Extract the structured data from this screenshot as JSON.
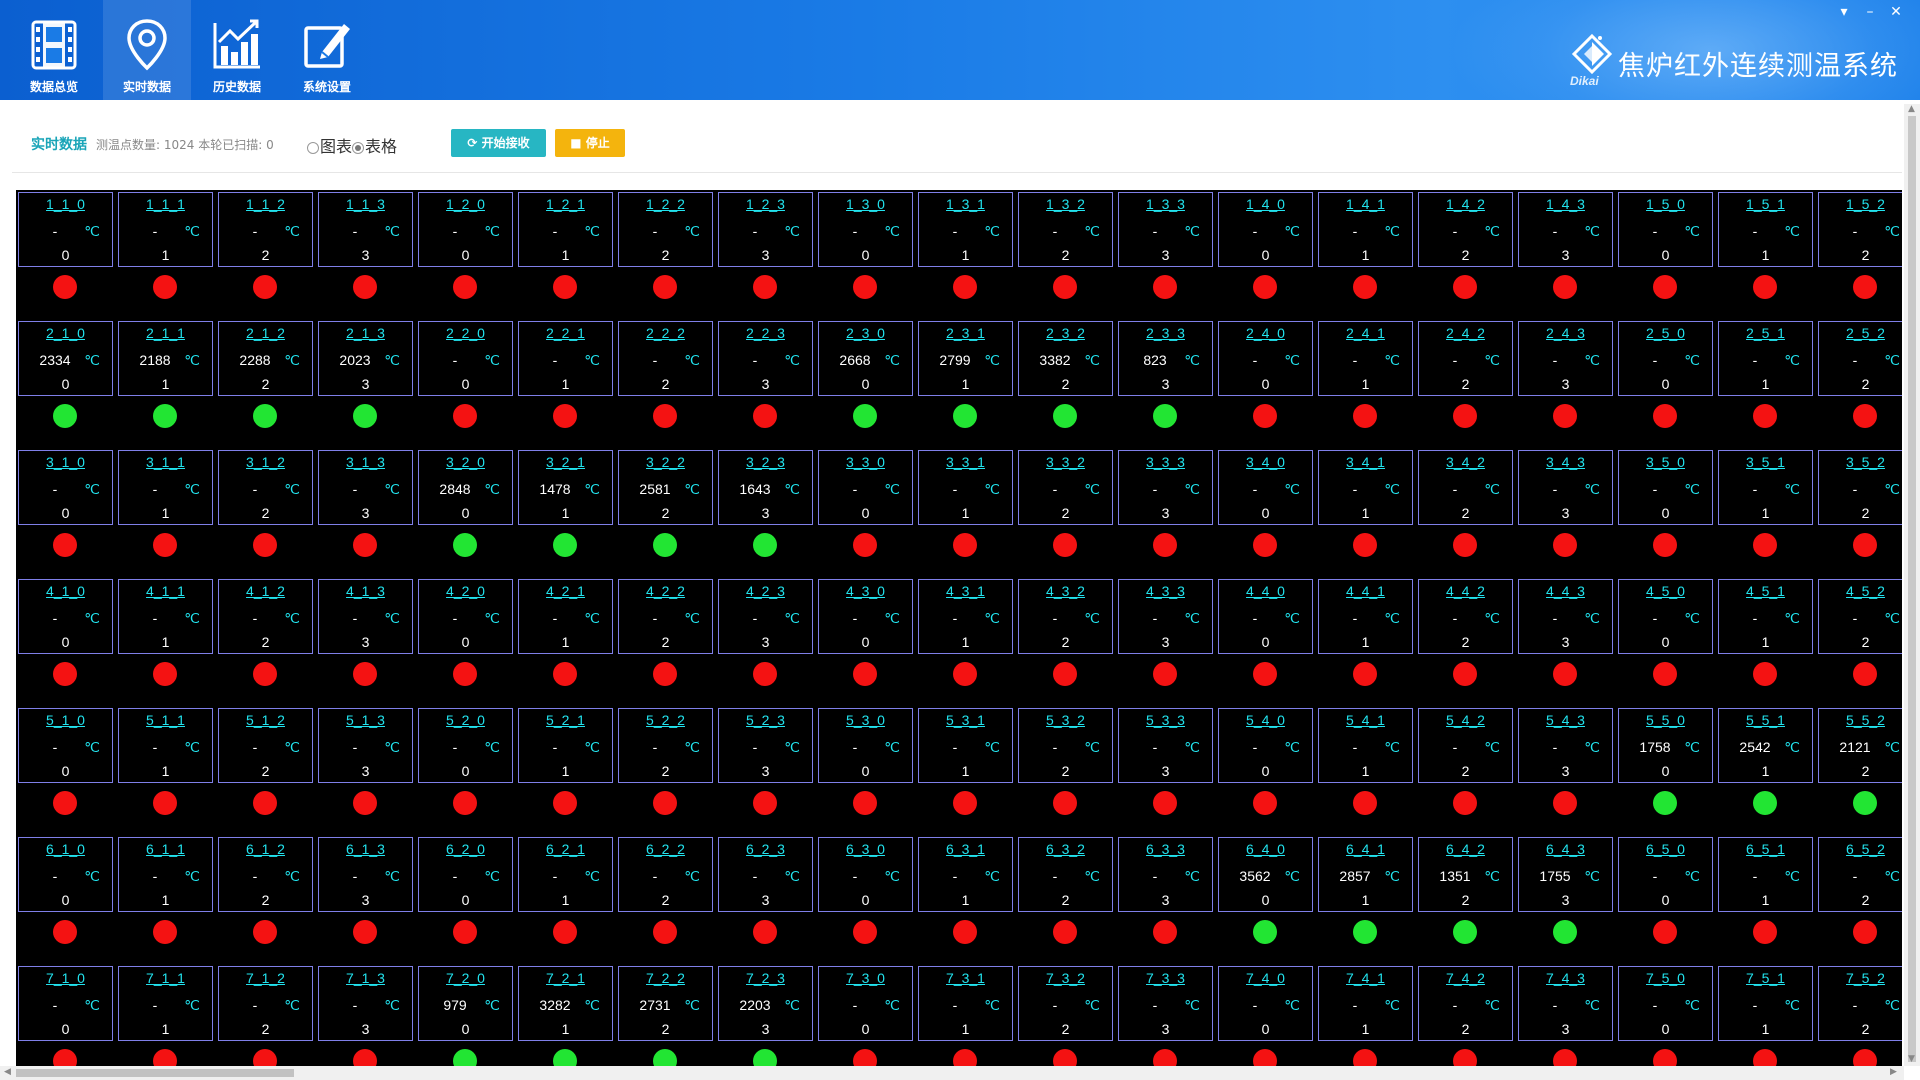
{
  "header": {
    "nav": [
      {
        "label": "数据总览",
        "icon": "film-icon"
      },
      {
        "label": "实时数据",
        "icon": "location-pin-icon"
      },
      {
        "label": "历史数据",
        "icon": "bar-chart-icon"
      },
      {
        "label": "系统设置",
        "icon": "edit-icon"
      }
    ],
    "active_nav": 1,
    "app_title": "焦炉红外连续测温系统",
    "logo_text": "Dikai",
    "controls": {
      "menu": "▾",
      "minimize": "–",
      "close": "✕"
    }
  },
  "toolbar": {
    "title": "实时数据",
    "count_text": "测温点数量: 1024 本轮已扫描: 0",
    "view_options": [
      {
        "label": "图表",
        "checked": false
      },
      {
        "label": "表格",
        "checked": true
      }
    ],
    "start_label": "开始接收",
    "stop_label": "停止"
  },
  "grid": {
    "unit": "℃",
    "colors": {
      "ok": "#22e533",
      "bad": "#f41212",
      "id": "#22e3ee",
      "border": "#7f7fe8"
    },
    "rows": [
      {
        "row": 1,
        "cells": [
          {
            "id": "1_1_0",
            "value": "-",
            "sub": "0",
            "ok": false
          },
          {
            "id": "1_1_1",
            "value": "-",
            "sub": "1",
            "ok": false
          },
          {
            "id": "1_1_2",
            "value": "-",
            "sub": "2",
            "ok": false
          },
          {
            "id": "1_1_3",
            "value": "-",
            "sub": "3",
            "ok": false
          },
          {
            "id": "1_2_0",
            "value": "-",
            "sub": "0",
            "ok": false
          },
          {
            "id": "1_2_1",
            "value": "-",
            "sub": "1",
            "ok": false
          },
          {
            "id": "1_2_2",
            "value": "-",
            "sub": "2",
            "ok": false
          },
          {
            "id": "1_2_3",
            "value": "-",
            "sub": "3",
            "ok": false
          },
          {
            "id": "1_3_0",
            "value": "-",
            "sub": "0",
            "ok": false
          },
          {
            "id": "1_3_1",
            "value": "-",
            "sub": "1",
            "ok": false
          },
          {
            "id": "1_3_2",
            "value": "-",
            "sub": "2",
            "ok": false
          },
          {
            "id": "1_3_3",
            "value": "-",
            "sub": "3",
            "ok": false
          },
          {
            "id": "1_4_0",
            "value": "-",
            "sub": "0",
            "ok": false
          },
          {
            "id": "1_4_1",
            "value": "-",
            "sub": "1",
            "ok": false
          },
          {
            "id": "1_4_2",
            "value": "-",
            "sub": "2",
            "ok": false
          },
          {
            "id": "1_4_3",
            "value": "-",
            "sub": "3",
            "ok": false
          },
          {
            "id": "1_5_0",
            "value": "-",
            "sub": "0",
            "ok": false
          },
          {
            "id": "1_5_1",
            "value": "-",
            "sub": "1",
            "ok": false
          },
          {
            "id": "1_5_2",
            "value": "-",
            "sub": "2",
            "ok": false
          }
        ]
      },
      {
        "row": 2,
        "cells": [
          {
            "id": "2_1_0",
            "value": "2334",
            "sub": "0",
            "ok": true
          },
          {
            "id": "2_1_1",
            "value": "2188",
            "sub": "1",
            "ok": true
          },
          {
            "id": "2_1_2",
            "value": "2288",
            "sub": "2",
            "ok": true
          },
          {
            "id": "2_1_3",
            "value": "2023",
            "sub": "3",
            "ok": true
          },
          {
            "id": "2_2_0",
            "value": "-",
            "sub": "0",
            "ok": false
          },
          {
            "id": "2_2_1",
            "value": "-",
            "sub": "1",
            "ok": false
          },
          {
            "id": "2_2_2",
            "value": "-",
            "sub": "2",
            "ok": false
          },
          {
            "id": "2_2_3",
            "value": "-",
            "sub": "3",
            "ok": false
          },
          {
            "id": "2_3_0",
            "value": "2668",
            "sub": "0",
            "ok": true
          },
          {
            "id": "2_3_1",
            "value": "2799",
            "sub": "1",
            "ok": true
          },
          {
            "id": "2_3_2",
            "value": "3382",
            "sub": "2",
            "ok": true
          },
          {
            "id": "2_3_3",
            "value": "823",
            "sub": "3",
            "ok": true
          },
          {
            "id": "2_4_0",
            "value": "-",
            "sub": "0",
            "ok": false
          },
          {
            "id": "2_4_1",
            "value": "-",
            "sub": "1",
            "ok": false
          },
          {
            "id": "2_4_2",
            "value": "-",
            "sub": "2",
            "ok": false
          },
          {
            "id": "2_4_3",
            "value": "-",
            "sub": "3",
            "ok": false
          },
          {
            "id": "2_5_0",
            "value": "-",
            "sub": "0",
            "ok": false
          },
          {
            "id": "2_5_1",
            "value": "-",
            "sub": "1",
            "ok": false
          },
          {
            "id": "2_5_2",
            "value": "-",
            "sub": "2",
            "ok": false
          }
        ]
      },
      {
        "row": 3,
        "cells": [
          {
            "id": "3_1_0",
            "value": "-",
            "sub": "0",
            "ok": false
          },
          {
            "id": "3_1_1",
            "value": "-",
            "sub": "1",
            "ok": false
          },
          {
            "id": "3_1_2",
            "value": "-",
            "sub": "2",
            "ok": false
          },
          {
            "id": "3_1_3",
            "value": "-",
            "sub": "3",
            "ok": false
          },
          {
            "id": "3_2_0",
            "value": "2848",
            "sub": "0",
            "ok": true
          },
          {
            "id": "3_2_1",
            "value": "1478",
            "sub": "1",
            "ok": true
          },
          {
            "id": "3_2_2",
            "value": "2581",
            "sub": "2",
            "ok": true
          },
          {
            "id": "3_2_3",
            "value": "1643",
            "sub": "3",
            "ok": true
          },
          {
            "id": "3_3_0",
            "value": "-",
            "sub": "0",
            "ok": false
          },
          {
            "id": "3_3_1",
            "value": "-",
            "sub": "1",
            "ok": false
          },
          {
            "id": "3_3_2",
            "value": "-",
            "sub": "2",
            "ok": false
          },
          {
            "id": "3_3_3",
            "value": "-",
            "sub": "3",
            "ok": false
          },
          {
            "id": "3_4_0",
            "value": "-",
            "sub": "0",
            "ok": false
          },
          {
            "id": "3_4_1",
            "value": "-",
            "sub": "1",
            "ok": false
          },
          {
            "id": "3_4_2",
            "value": "-",
            "sub": "2",
            "ok": false
          },
          {
            "id": "3_4_3",
            "value": "-",
            "sub": "3",
            "ok": false
          },
          {
            "id": "3_5_0",
            "value": "-",
            "sub": "0",
            "ok": false
          },
          {
            "id": "3_5_1",
            "value": "-",
            "sub": "1",
            "ok": false
          },
          {
            "id": "3_5_2",
            "value": "-",
            "sub": "2",
            "ok": false
          }
        ]
      },
      {
        "row": 4,
        "cells": [
          {
            "id": "4_1_0",
            "value": "-",
            "sub": "0",
            "ok": false
          },
          {
            "id": "4_1_1",
            "value": "-",
            "sub": "1",
            "ok": false
          },
          {
            "id": "4_1_2",
            "value": "-",
            "sub": "2",
            "ok": false
          },
          {
            "id": "4_1_3",
            "value": "-",
            "sub": "3",
            "ok": false
          },
          {
            "id": "4_2_0",
            "value": "-",
            "sub": "0",
            "ok": false
          },
          {
            "id": "4_2_1",
            "value": "-",
            "sub": "1",
            "ok": false
          },
          {
            "id": "4_2_2",
            "value": "-",
            "sub": "2",
            "ok": false
          },
          {
            "id": "4_2_3",
            "value": "-",
            "sub": "3",
            "ok": false
          },
          {
            "id": "4_3_0",
            "value": "-",
            "sub": "0",
            "ok": false
          },
          {
            "id": "4_3_1",
            "value": "-",
            "sub": "1",
            "ok": false
          },
          {
            "id": "4_3_2",
            "value": "-",
            "sub": "2",
            "ok": false
          },
          {
            "id": "4_3_3",
            "value": "-",
            "sub": "3",
            "ok": false
          },
          {
            "id": "4_4_0",
            "value": "-",
            "sub": "0",
            "ok": false
          },
          {
            "id": "4_4_1",
            "value": "-",
            "sub": "1",
            "ok": false
          },
          {
            "id": "4_4_2",
            "value": "-",
            "sub": "2",
            "ok": false
          },
          {
            "id": "4_4_3",
            "value": "-",
            "sub": "3",
            "ok": false
          },
          {
            "id": "4_5_0",
            "value": "-",
            "sub": "0",
            "ok": false
          },
          {
            "id": "4_5_1",
            "value": "-",
            "sub": "1",
            "ok": false
          },
          {
            "id": "4_5_2",
            "value": "-",
            "sub": "2",
            "ok": false
          }
        ]
      },
      {
        "row": 5,
        "cells": [
          {
            "id": "5_1_0",
            "value": "-",
            "sub": "0",
            "ok": false
          },
          {
            "id": "5_1_1",
            "value": "-",
            "sub": "1",
            "ok": false
          },
          {
            "id": "5_1_2",
            "value": "-",
            "sub": "2",
            "ok": false
          },
          {
            "id": "5_1_3",
            "value": "-",
            "sub": "3",
            "ok": false
          },
          {
            "id": "5_2_0",
            "value": "-",
            "sub": "0",
            "ok": false
          },
          {
            "id": "5_2_1",
            "value": "-",
            "sub": "1",
            "ok": false
          },
          {
            "id": "5_2_2",
            "value": "-",
            "sub": "2",
            "ok": false
          },
          {
            "id": "5_2_3",
            "value": "-",
            "sub": "3",
            "ok": false
          },
          {
            "id": "5_3_0",
            "value": "-",
            "sub": "0",
            "ok": false
          },
          {
            "id": "5_3_1",
            "value": "-",
            "sub": "1",
            "ok": false
          },
          {
            "id": "5_3_2",
            "value": "-",
            "sub": "2",
            "ok": false
          },
          {
            "id": "5_3_3",
            "value": "-",
            "sub": "3",
            "ok": false
          },
          {
            "id": "5_4_0",
            "value": "-",
            "sub": "0",
            "ok": false
          },
          {
            "id": "5_4_1",
            "value": "-",
            "sub": "1",
            "ok": false
          },
          {
            "id": "5_4_2",
            "value": "-",
            "sub": "2",
            "ok": false
          },
          {
            "id": "5_4_3",
            "value": "-",
            "sub": "3",
            "ok": false
          },
          {
            "id": "5_5_0",
            "value": "1758",
            "sub": "0",
            "ok": true
          },
          {
            "id": "5_5_1",
            "value": "2542",
            "sub": "1",
            "ok": true
          },
          {
            "id": "5_5_2",
            "value": "2121",
            "sub": "2",
            "ok": true
          }
        ]
      },
      {
        "row": 6,
        "cells": [
          {
            "id": "6_1_0",
            "value": "-",
            "sub": "0",
            "ok": false
          },
          {
            "id": "6_1_1",
            "value": "-",
            "sub": "1",
            "ok": false
          },
          {
            "id": "6_1_2",
            "value": "-",
            "sub": "2",
            "ok": false
          },
          {
            "id": "6_1_3",
            "value": "-",
            "sub": "3",
            "ok": false
          },
          {
            "id": "6_2_0",
            "value": "-",
            "sub": "0",
            "ok": false
          },
          {
            "id": "6_2_1",
            "value": "-",
            "sub": "1",
            "ok": false
          },
          {
            "id": "6_2_2",
            "value": "-",
            "sub": "2",
            "ok": false
          },
          {
            "id": "6_2_3",
            "value": "-",
            "sub": "3",
            "ok": false
          },
          {
            "id": "6_3_0",
            "value": "-",
            "sub": "0",
            "ok": false
          },
          {
            "id": "6_3_1",
            "value": "-",
            "sub": "1",
            "ok": false
          },
          {
            "id": "6_3_2",
            "value": "-",
            "sub": "2",
            "ok": false
          },
          {
            "id": "6_3_3",
            "value": "-",
            "sub": "3",
            "ok": false
          },
          {
            "id": "6_4_0",
            "value": "3562",
            "sub": "0",
            "ok": true
          },
          {
            "id": "6_4_1",
            "value": "2857",
            "sub": "1",
            "ok": true
          },
          {
            "id": "6_4_2",
            "value": "1351",
            "sub": "2",
            "ok": true
          },
          {
            "id": "6_4_3",
            "value": "1755",
            "sub": "3",
            "ok": true
          },
          {
            "id": "6_5_0",
            "value": "-",
            "sub": "0",
            "ok": false
          },
          {
            "id": "6_5_1",
            "value": "-",
            "sub": "1",
            "ok": false
          },
          {
            "id": "6_5_2",
            "value": "-",
            "sub": "2",
            "ok": false
          }
        ]
      },
      {
        "row": 7,
        "cells": [
          {
            "id": "7_1_0",
            "value": "-",
            "sub": "0",
            "ok": false
          },
          {
            "id": "7_1_1",
            "value": "-",
            "sub": "1",
            "ok": false
          },
          {
            "id": "7_1_2",
            "value": "-",
            "sub": "2",
            "ok": false
          },
          {
            "id": "7_1_3",
            "value": "-",
            "sub": "3",
            "ok": false
          },
          {
            "id": "7_2_0",
            "value": "979",
            "sub": "0",
            "ok": true
          },
          {
            "id": "7_2_1",
            "value": "3282",
            "sub": "1",
            "ok": true
          },
          {
            "id": "7_2_2",
            "value": "2731",
            "sub": "2",
            "ok": true
          },
          {
            "id": "7_2_3",
            "value": "2203",
            "sub": "3",
            "ok": true
          },
          {
            "id": "7_3_0",
            "value": "-",
            "sub": "0",
            "ok": false
          },
          {
            "id": "7_3_1",
            "value": "-",
            "sub": "1",
            "ok": false
          },
          {
            "id": "7_3_2",
            "value": "-",
            "sub": "2",
            "ok": false
          },
          {
            "id": "7_3_3",
            "value": "-",
            "sub": "3",
            "ok": false
          },
          {
            "id": "7_4_0",
            "value": "-",
            "sub": "0",
            "ok": false
          },
          {
            "id": "7_4_1",
            "value": "-",
            "sub": "1",
            "ok": false
          },
          {
            "id": "7_4_2",
            "value": "-",
            "sub": "2",
            "ok": false
          },
          {
            "id": "7_4_3",
            "value": "-",
            "sub": "3",
            "ok": false
          },
          {
            "id": "7_5_0",
            "value": "-",
            "sub": "0",
            "ok": false
          },
          {
            "id": "7_5_1",
            "value": "-",
            "sub": "1",
            "ok": false
          },
          {
            "id": "7_5_2",
            "value": "-",
            "sub": "2",
            "ok": false
          }
        ]
      }
    ]
  }
}
